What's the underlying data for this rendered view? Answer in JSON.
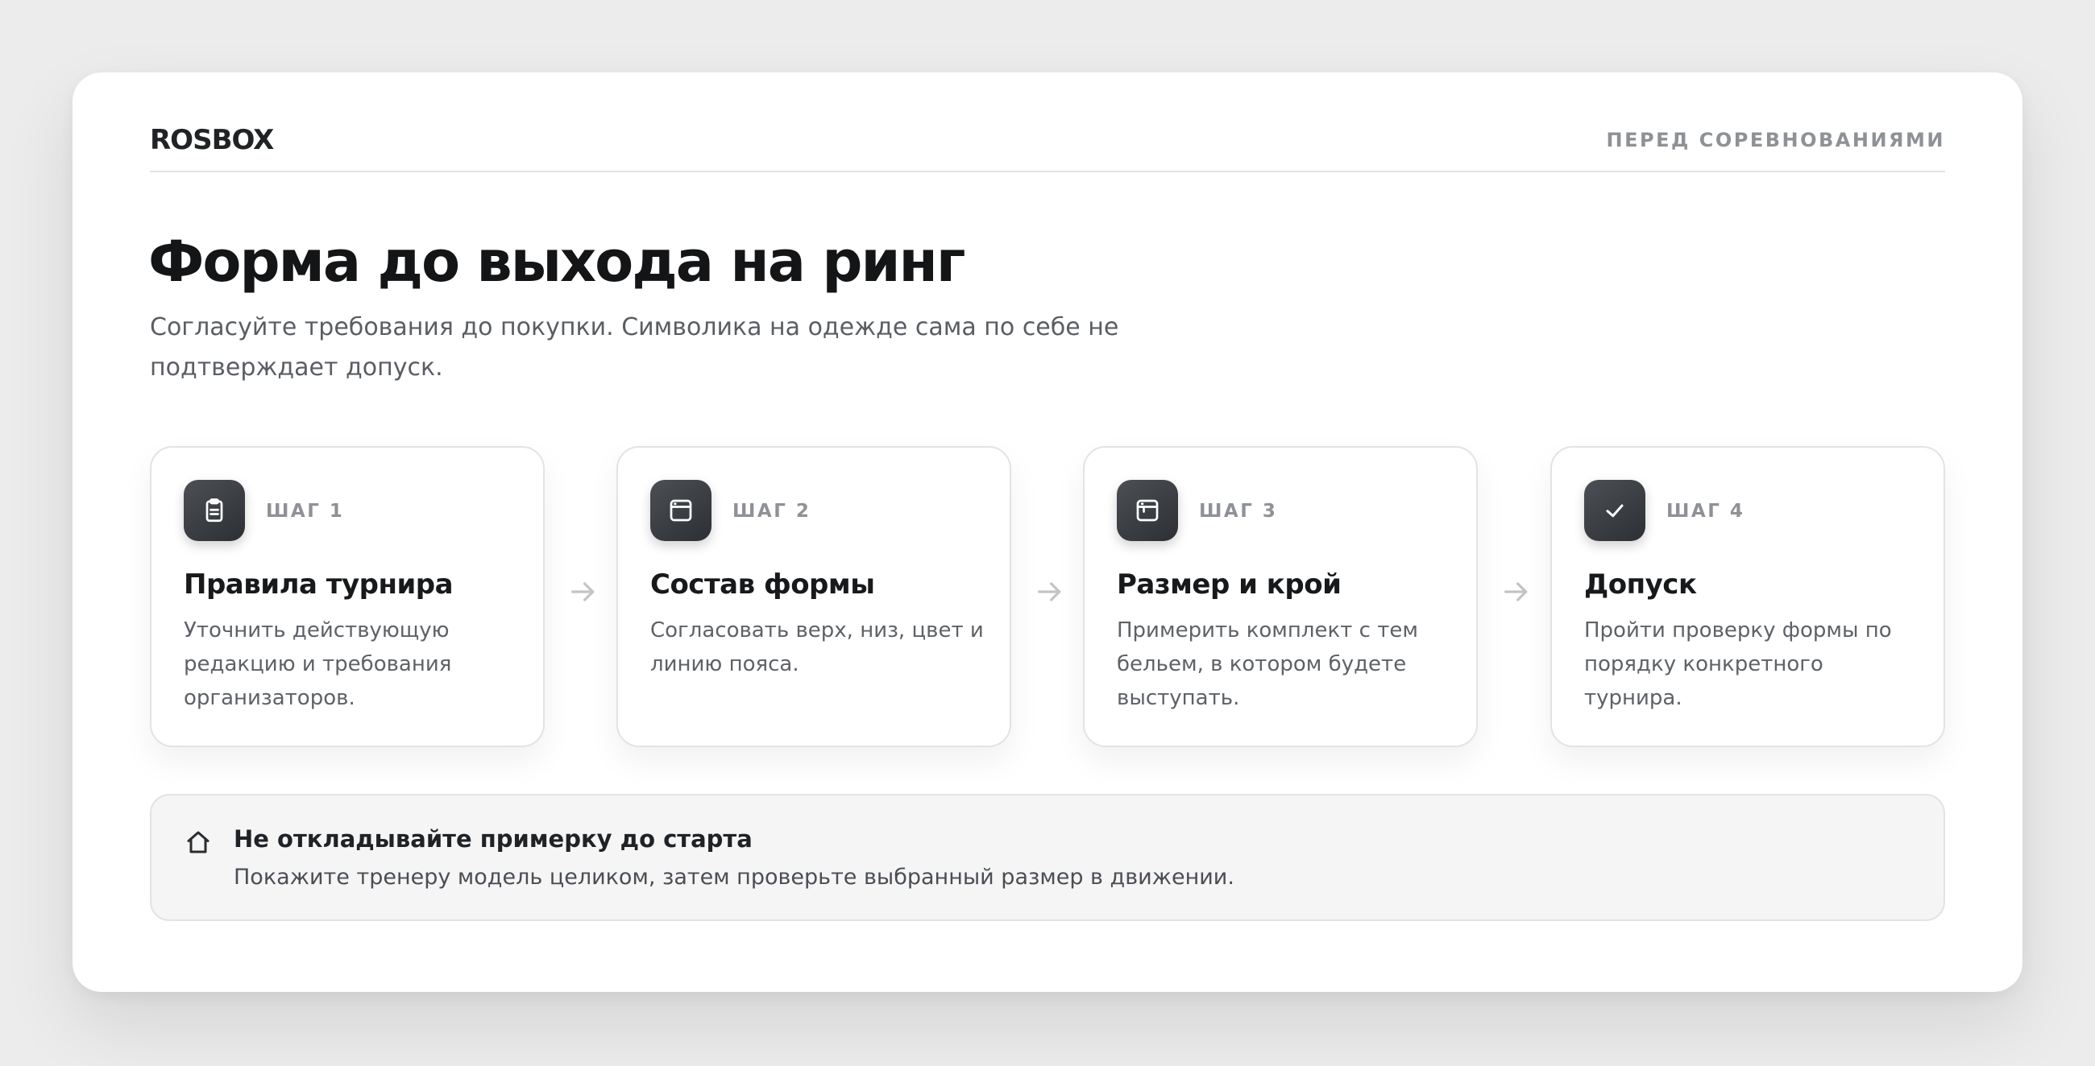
{
  "header": {
    "brand": "ROSBOX",
    "section_tag": "ПЕРЕД СОРЕВНОВАНИЯМИ"
  },
  "main": {
    "title": "Форма до выхода на ринг",
    "subtitle": "Согласуйте требования до покупки. Символика на одежде сама по себе не подтверждает допуск."
  },
  "steps": [
    {
      "label": "ШАГ 1",
      "title": "Правила турнира",
      "description": "Уточнить действующую редакцию и требования организаторов.",
      "icon": "clipboard-icon"
    },
    {
      "label": "ШАГ 2",
      "title": "Состав формы",
      "description": "Согласовать верх, низ, цвет и линию пояса.",
      "icon": "window-icon"
    },
    {
      "label": "ШАГ 3",
      "title": "Размер и крой",
      "description": "Примерить комплект с тем бельем, в котором будете выступать.",
      "icon": "frame-icon"
    },
    {
      "label": "ШАГ 4",
      "title": "Допуск",
      "description": "Пройти проверку формы по порядку конкретного турнира.",
      "icon": "check-icon"
    }
  ],
  "tip": {
    "icon": "home-icon",
    "title": "Не откладывайте примерку до старта",
    "text": "Покажите тренеру модель целиком, затем проверьте выбранный размер в движении."
  },
  "colors": {
    "background": "#ececed",
    "card": "#ffffff",
    "icon_tile": "#3a3d41",
    "muted_text": "#8e9195",
    "tip_background": "#f5f5f6"
  }
}
